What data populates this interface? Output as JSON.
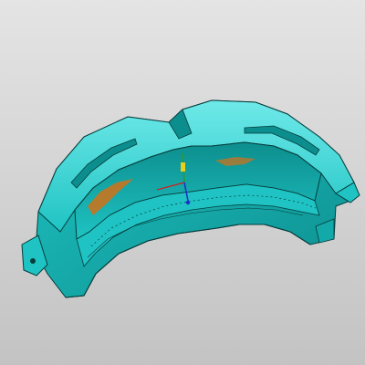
{
  "viewport": {
    "background_top": "#e4e4e4",
    "background_bottom": "#c3c3c3"
  },
  "model": {
    "icon": "goggle-frame-3d-model",
    "body_color": "#1fc3c3",
    "highlight_color": "#6fe9e9",
    "shadow_color": "#0d8e8e",
    "edge_color": "#063c3c",
    "inner_accent_color": "#c8741f"
  },
  "triad": {
    "icon": "axis-triad-icon",
    "x_axis_color": "#cc2222",
    "y_axis_color": "#2e9a2e",
    "z_axis_color": "#1e2fd0",
    "origin_color": "#e6d21a"
  }
}
